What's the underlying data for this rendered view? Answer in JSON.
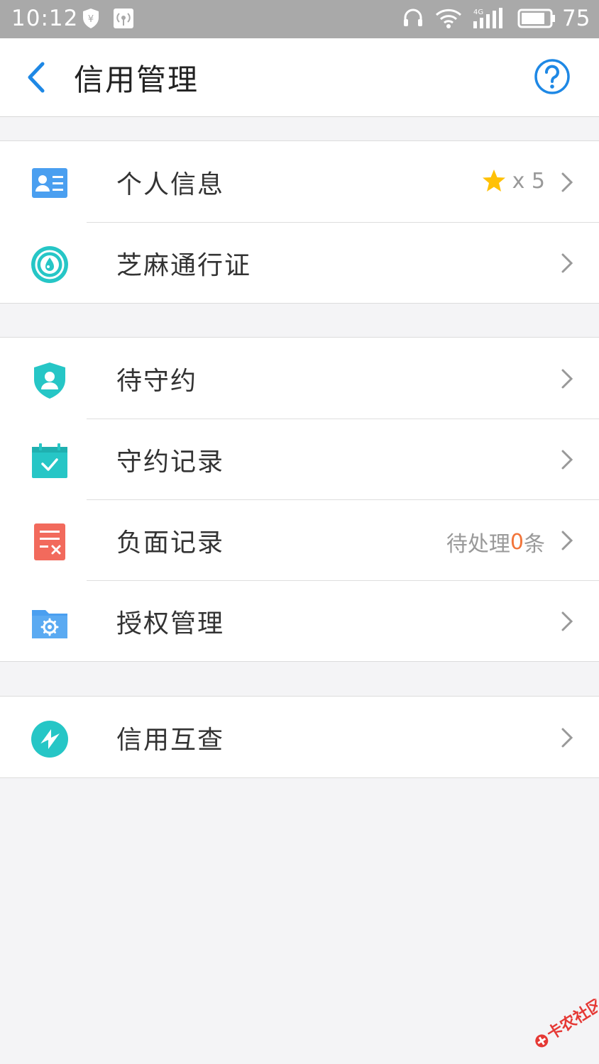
{
  "status_bar": {
    "time": "10:12",
    "battery": "75",
    "icons": [
      "shield-yen-icon",
      "radio-signal-icon",
      "headset-icon",
      "wifi-icon",
      "signal-4g-icon",
      "battery-icon"
    ]
  },
  "header": {
    "title": "信用管理",
    "back_icon": "chevron-left-icon",
    "help_icon": "question-circle-icon"
  },
  "groups": [
    {
      "rows": [
        {
          "label": "个人信息",
          "icon": "id-card-icon",
          "extra_star": "x 5"
        },
        {
          "label": "芝麻通行证",
          "icon": "sesame-pass-icon"
        }
      ]
    },
    {
      "rows": [
        {
          "label": "待守约",
          "icon": "shield-user-icon"
        },
        {
          "label": "守约记录",
          "icon": "calendar-check-icon"
        },
        {
          "label": "负面记录",
          "icon": "document-x-icon",
          "extra_prefix": "待处理",
          "extra_count": "0",
          "extra_suffix": "条"
        },
        {
          "label": "授权管理",
          "icon": "folder-gear-icon"
        }
      ]
    },
    {
      "rows": [
        {
          "label": "信用互查",
          "icon": "mutual-check-icon"
        }
      ]
    }
  ],
  "colors": {
    "accent_blue": "#1e88e5",
    "teal": "#26c6c6",
    "red": "#f26a5c",
    "star": "#ffc107",
    "orange_count": "#f2753a"
  },
  "watermark": "卡农社区"
}
